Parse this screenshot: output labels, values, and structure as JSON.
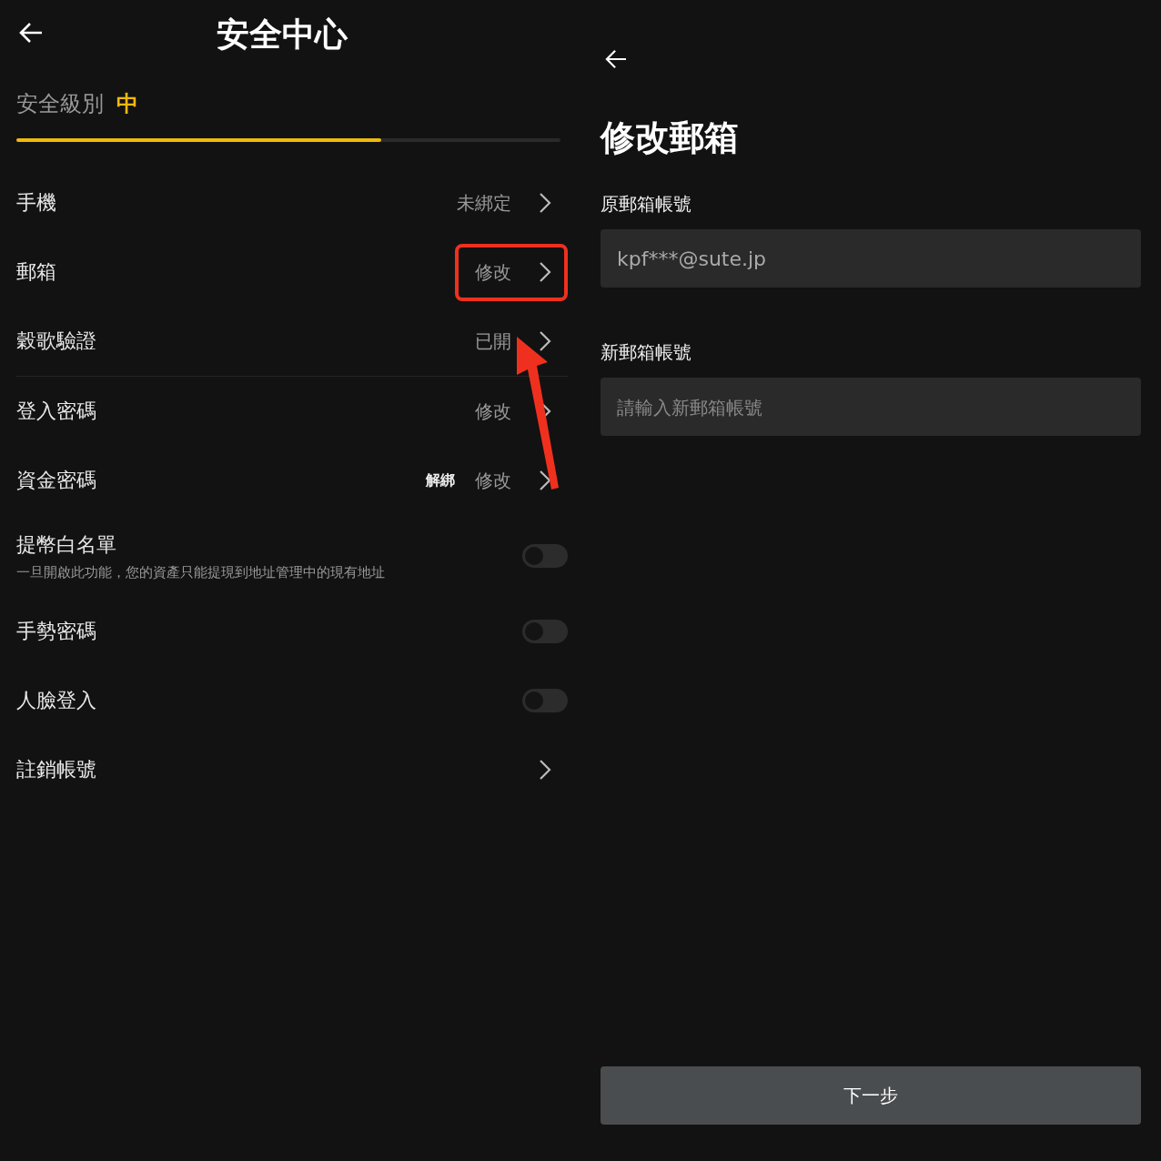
{
  "security_center": {
    "title": "安全中心",
    "level_label": "安全級別",
    "level_value": "中",
    "level": 0.67,
    "groups": [
      [
        {
          "kind": "link",
          "label": "手機",
          "values": [
            "未綁定"
          ],
          "highlighted": false
        },
        {
          "kind": "link",
          "label": "郵箱",
          "values": [
            "修改"
          ],
          "highlighted": true
        },
        {
          "kind": "link",
          "label": "穀歌驗證",
          "values": [
            "已開"
          ],
          "highlighted": false
        }
      ],
      [
        {
          "kind": "link",
          "label": "登入密碼",
          "values": [
            "修改"
          ],
          "highlighted": false
        },
        {
          "kind": "link",
          "label": "資金密碼",
          "extra": "解綁",
          "values": [
            "修改"
          ],
          "highlighted": false
        },
        {
          "kind": "toggle",
          "label": "提幣白名單",
          "description": "一旦開啟此功能，您的資產只能提現到地址管理中的現有地址",
          "on": false
        },
        {
          "kind": "toggle",
          "label": "手勢密碼",
          "on": false
        },
        {
          "kind": "toggle",
          "label": "人臉登入",
          "on": false
        },
        {
          "kind": "link",
          "label": "註銷帳號",
          "highlighted": false
        }
      ]
    ]
  },
  "change_email": {
    "title": "修改郵箱",
    "fields": [
      {
        "label": "原郵箱帳號",
        "value": "kpf***@sute.jp"
      },
      {
        "label": "新郵箱帳號",
        "placeholder": "請輸入新郵箱帳號"
      }
    ],
    "button": "下一步"
  }
}
